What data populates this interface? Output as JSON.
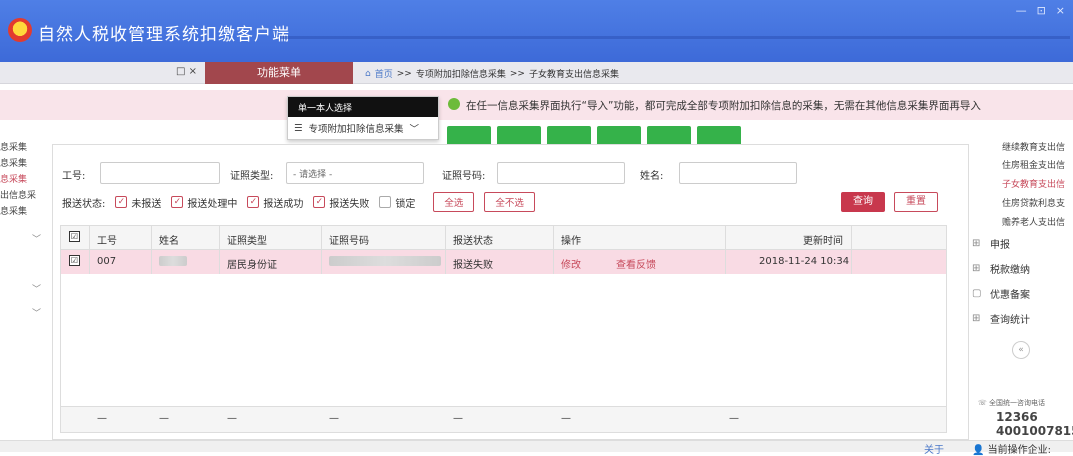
{
  "app": {
    "title": "自然人税收管理系统扣缴客户端"
  },
  "window_controls": {
    "minimize": "—",
    "restore": "⊡",
    "close": "×"
  },
  "bar2": {
    "tab_close": "□ ×",
    "menu_header": "功能菜单"
  },
  "breadcrumb": {
    "home": "首页",
    "sep": ">>",
    "level1": "专项附加扣除信息采集",
    "level2": "子女教育支出信息采集"
  },
  "notice": "在任一信息采集界面执行“导入”功能，都可完成全部专项附加扣除信息的采集，无需在其他信息采集界面再导入",
  "dropdown": {
    "item1": "单一本人选择",
    "item2": "专项附加扣除信息采集",
    "item2_chevron": "﹀"
  },
  "left_sidebar": {
    "items": [
      "息采集",
      "息采集",
      "息采集",
      "出信息采",
      "息采集"
    ],
    "active_index": 2,
    "chevron": "﹀"
  },
  "filters": {
    "id_label": "工号:",
    "id_type_label": "证照类型:",
    "id_type_value": "- 请选择 -",
    "id_number_label": "证照号码:",
    "name_label": "姓名:"
  },
  "status_filter": {
    "label": "报送状态:",
    "options": [
      {
        "label": "未报送",
        "checked": true
      },
      {
        "label": "报送处理中",
        "checked": true
      },
      {
        "label": "报送成功",
        "checked": true
      },
      {
        "label": "报送失败",
        "checked": true
      },
      {
        "label": "锁定",
        "checked": false
      }
    ],
    "select_all": "全选",
    "select_none": "全不选"
  },
  "buttons": {
    "query": "查询",
    "reset": "重置"
  },
  "table": {
    "headers": [
      "工号",
      "姓名",
      "证照类型",
      "证照号码",
      "报送状态",
      "操作",
      "更新时间"
    ],
    "rows": [
      {
        "id": "007",
        "name": "",
        "id_type": "居民身份证",
        "id_number": "",
        "status": "报送失败",
        "action_edit": "修改",
        "action_feedback": "查看反馈",
        "updated": "2018-11-24 10:34"
      }
    ],
    "footer": [
      "—",
      "—",
      "—",
      "—",
      "—",
      "—",
      "—"
    ],
    "check_mark": "☑"
  },
  "right_sidebar": {
    "sub_items": [
      "继续教育支出信",
      "住房租金支出信",
      "子女教育支出信",
      "住房贷款利息支",
      "赡养老人支出信"
    ],
    "active_sub": 2,
    "main_items": [
      {
        "label": "申报",
        "icon": "grid-icon"
      },
      {
        "label": "税款缴纳",
        "icon": "grid-icon"
      },
      {
        "label": "优惠备案",
        "icon": "document-icon"
      },
      {
        "label": "查询统计",
        "icon": "grid-icon"
      }
    ],
    "collapse": "«",
    "hotline_label": "全国统一咨询电话",
    "phone1": "12366",
    "phone2": "4001007815"
  },
  "status_bar": {
    "about": "关于",
    "current_corp": "当前操作企业:"
  },
  "colors": {
    "title_bg": "#3d6ad8",
    "accent": "#c8384d",
    "menu_header": "#a2474d",
    "row_highlight": "#f9dbe4"
  }
}
